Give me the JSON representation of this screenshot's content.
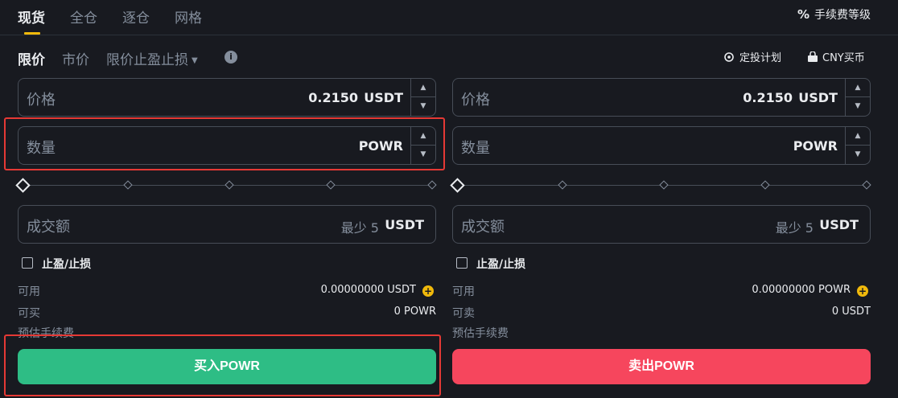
{
  "colors": {
    "accent": "#f0b90b",
    "buy": "#2ebd85",
    "sell": "#f6465d",
    "background": "#181a20",
    "highlight_box": "#e53935"
  },
  "top_tabs": [
    {
      "label": "现货",
      "active": true
    },
    {
      "label": "全仓",
      "active": false
    },
    {
      "label": "逐仓",
      "active": false
    },
    {
      "label": "网格",
      "active": false
    }
  ],
  "fee_level": {
    "label": "手续费等级",
    "icon": "percent-icon"
  },
  "order_types": {
    "limit": "限价",
    "market": "市价",
    "stop_limit": "限价止盈止损",
    "selected": "限价"
  },
  "right_links": {
    "auto_invest": {
      "label": "定投计划",
      "icon": "auto-invest-icon"
    },
    "cny_buy": {
      "label": "CNY买币",
      "icon": "card-icon"
    }
  },
  "buy_panel": {
    "price": {
      "label": "价格",
      "value": "0.2150",
      "unit": "USDT"
    },
    "amount": {
      "label": "数量",
      "value": "",
      "unit": "POWR"
    },
    "total": {
      "label": "成交额",
      "min_hint": "最少 5",
      "unit": "USDT"
    },
    "tpsl_label": "止盈/止损",
    "available_label": "可用",
    "available_value": "0.00000000 USDT",
    "max_label": "可买",
    "max_value": "0 POWR",
    "fee_label": "预估手续费",
    "button_label": "买入POWR"
  },
  "sell_panel": {
    "price": {
      "label": "价格",
      "value": "0.2150",
      "unit": "USDT"
    },
    "amount": {
      "label": "数量",
      "value": "",
      "unit": "POWR"
    },
    "total": {
      "label": "成交额",
      "min_hint": "最少 5",
      "unit": "USDT"
    },
    "tpsl_label": "止盈/止损",
    "available_label": "可用",
    "available_value": "0.00000000 POWR",
    "max_label": "可卖",
    "max_value": "0 USDT",
    "fee_label": "预估手续费",
    "button_label": "卖出POWR"
  },
  "slider": {
    "buy_percent": 0,
    "sell_percent": 0
  }
}
